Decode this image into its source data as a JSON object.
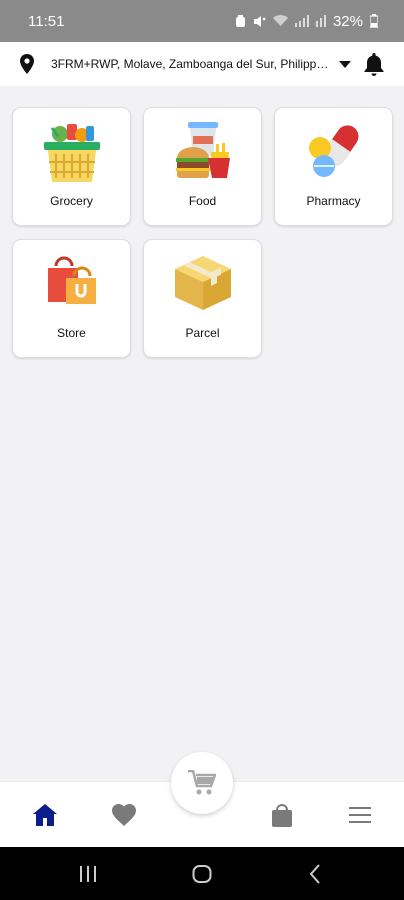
{
  "status_bar": {
    "time": "11:51",
    "battery": "32%"
  },
  "header": {
    "address": "3FRM+RWP, Molave, Zamboanga del Sur, Philippin...",
    "icons": [
      "location-pin-icon",
      "caret-down-icon",
      "bell-icon"
    ]
  },
  "categories": [
    {
      "label": "Grocery",
      "icon": "grocery-basket-icon"
    },
    {
      "label": "Food",
      "icon": "food-icon"
    },
    {
      "label": "Pharmacy",
      "icon": "pharmacy-pills-icon"
    },
    {
      "label": "Store",
      "icon": "shopping-bags-icon"
    },
    {
      "label": "Parcel",
      "icon": "parcel-box-icon"
    }
  ],
  "bottom_nav": {
    "items": [
      "home-icon",
      "heart-icon",
      "cart-icon",
      "bag-icon",
      "menu-icon"
    ],
    "active": "home-icon"
  },
  "colors": {
    "active_nav": "#0b1f8a",
    "inactive_nav": "#7a7a7a",
    "status_bar": "#8a8a8a"
  }
}
